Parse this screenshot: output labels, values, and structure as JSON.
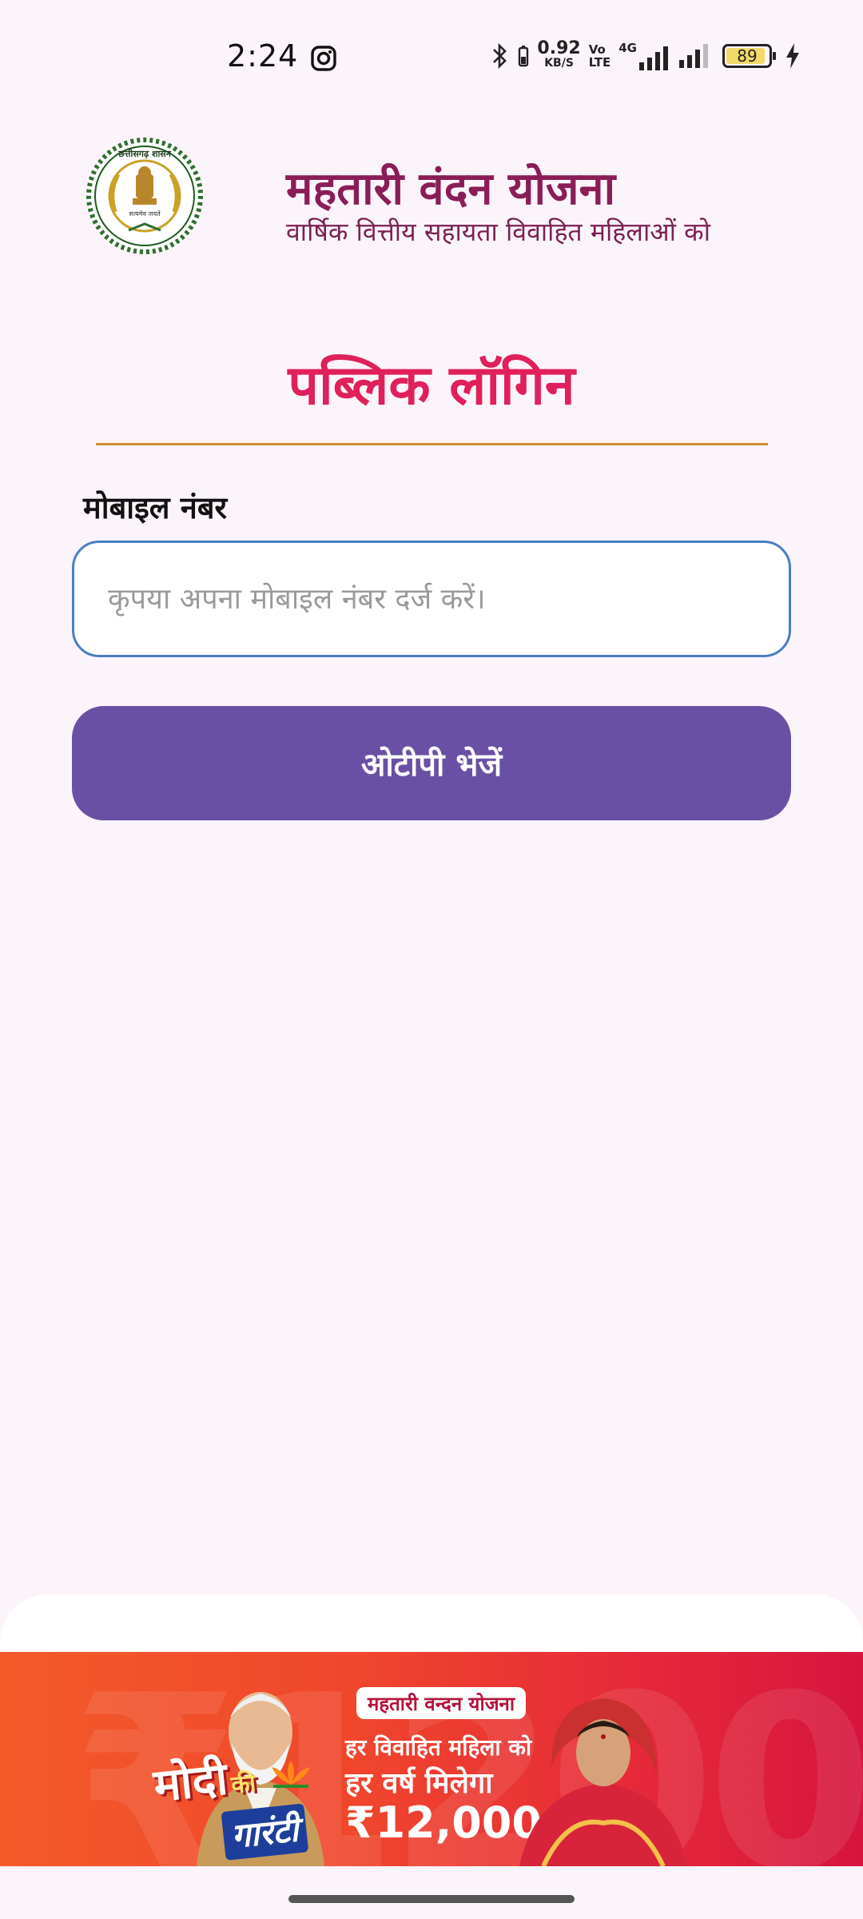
{
  "status_bar": {
    "time": "2:24",
    "net_speed_value": "0.92",
    "net_speed_unit": "KB/S",
    "volte_top": "Vo",
    "volte_bottom": "LTE",
    "network_type": "4G",
    "battery_level": "89",
    "icons": [
      "instagram-icon",
      "bluetooth-icon",
      "signal-icon",
      "battery-icon",
      "charging-icon"
    ]
  },
  "header": {
    "title": "महतारी वंदन योजना",
    "subtitle": "वार्षिक वित्तीय सहायता विवाहित महिलाओं को",
    "logo_text_top": "छत्तीसगढ़ शासन",
    "logo_text_bottom": "सत्यमेव जयते"
  },
  "login": {
    "heading": "पब्लिक लॉगिन",
    "mobile_label": "मोबाइल नंबर",
    "mobile_value": "",
    "mobile_placeholder": "कृपया अपना मोबाइल नंबर दर्ज करें।",
    "otp_button_label": "ओटीपी भेजें"
  },
  "banner": {
    "pill_text": "महतारी वन्दन योजना",
    "line1": "हर विवाहित महिला को",
    "line2": "हर वर्ष मिलेगा",
    "amount": "₹12,000",
    "guarantee_line1": "मोदी",
    "guarantee_ki": "की",
    "guarantee_line2": "गारंटी",
    "background_text": "₹12000"
  },
  "colors": {
    "background": "#fcf4fb",
    "title": "#8a1d58",
    "heading": "#e0205a",
    "divider": "#d08a2e",
    "input_border": "#4a7ec4",
    "button": "#6a50a4"
  }
}
